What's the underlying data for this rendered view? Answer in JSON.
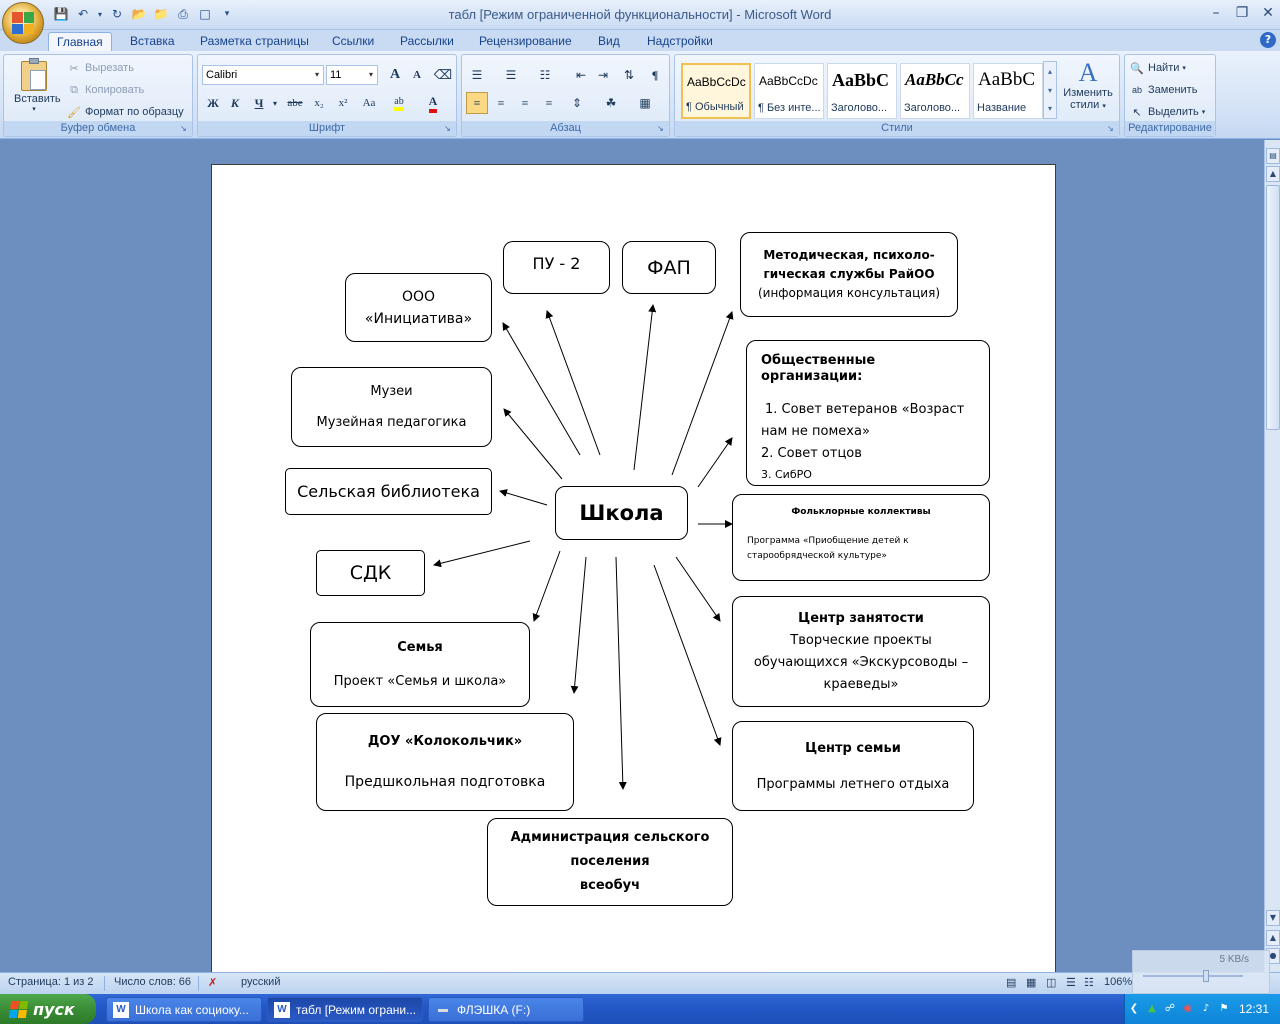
{
  "window": {
    "title": "табл [Режим ограниченной функциональности] - Microsoft Word"
  },
  "tabs": [
    "Главная",
    "Вставка",
    "Разметка страницы",
    "Ссылки",
    "Рассылки",
    "Рецензирование",
    "Вид",
    "Надстройки"
  ],
  "ribbon": {
    "clipboard": {
      "label": "Буфер обмена",
      "paste": "Вставить",
      "cut": "Вырезать",
      "copy": "Копировать",
      "format_painter": "Формат по образцу"
    },
    "font": {
      "label": "Шрифт",
      "font_name": "Calibri",
      "font_size": "11",
      "bold": "Ж",
      "italic": "К",
      "underline": "Ч",
      "strike": "abe",
      "subscript": "x₂",
      "superscript": "x²",
      "change_case": "Aa",
      "grow": "A",
      "shrink": "A"
    },
    "paragraph": {
      "label": "Абзац"
    },
    "styles": {
      "label": "Стили",
      "items": [
        {
          "sample": "AaBbCcDc",
          "name": "¶ Обычный"
        },
        {
          "sample": "AaBbCcDc",
          "name": "¶ Без инте..."
        },
        {
          "sample": "AaBbC",
          "name": "Заголово..."
        },
        {
          "sample": "AaBbCc",
          "name": "Заголово..."
        },
        {
          "sample": "AaBbC",
          "name": "Название"
        }
      ],
      "change_styles": [
        "Изменить",
        "стили"
      ]
    },
    "editing": {
      "label": "Редактирование",
      "find": "Найти",
      "replace": "Заменить",
      "select": "Выделить"
    }
  },
  "diagram": {
    "center": "Школа",
    "nodes": {
      "ooo": [
        "ООО",
        "«Инициатива»"
      ],
      "pu2": "ПУ - 2",
      "fap": "ФАП",
      "method": [
        "Методическая, психоло-",
        "гическая службы РайОО",
        "(информация консультация)"
      ],
      "museums": [
        "Музеи",
        "Музейная педагогика"
      ],
      "public_orgs": {
        "title": "Общественные организации:",
        "items": [
          "1. Совет ветеранов «Возраст",
          "нам не помеха»",
          "2. Совет отцов",
          "3. СибРО"
        ]
      },
      "library": "Сельская библиотека",
      "folklore": {
        "title": "Фольклорные коллективы",
        "text": [
          "Программа «Приобщение детей к",
          "старообрядческой культуре»"
        ]
      },
      "sdk": "СДК",
      "employment": {
        "title": "Центр занятости",
        "text": [
          "Творческие проекты",
          "обучающихся «Экскурсоводы –",
          "краеведы»"
        ]
      },
      "family": {
        "title": "Семья",
        "text": "Проект «Семья и школа»"
      },
      "dou": {
        "title": "ДОУ «Колокольчик»",
        "text": "Предшкольная подготовка"
      },
      "family_center": {
        "title": "Центр семьи",
        "text": "Программы летнего отдыха"
      },
      "admin": [
        "Администрация  сельского",
        "поселения",
        "всеобуч"
      ]
    }
  },
  "statusbar": {
    "page": "Страница: 1 из 2",
    "words": "Число слов: 66",
    "language": "русский",
    "zoom": "106%"
  },
  "netmon": {
    "speed": "5 KB/s"
  },
  "taskbar": {
    "start": "пуск",
    "tasks": [
      "Школа как социоку...",
      "табл [Режим ограни...",
      "ФЛЭШКА (F:)"
    ],
    "clock": "12:31"
  }
}
